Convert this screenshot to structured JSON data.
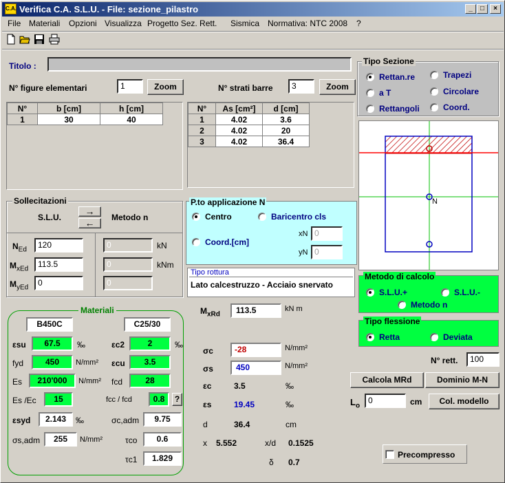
{
  "window": {
    "title": "Verifica C.A. S.L.U. - File: sezione_pilastro",
    "icon_text": "C.A.",
    "min": "_",
    "max": "□",
    "close": "×"
  },
  "menu": [
    "File",
    "Materiali",
    "Opzioni",
    "Visualizza",
    "Progetto Sez. Rett.",
    "Sismica",
    "Normativa: NTC 2008",
    "?"
  ],
  "titolo": {
    "label": "Titolo :",
    "value": ""
  },
  "figure": {
    "label": "N° figure elementari",
    "value": "1",
    "zoom": "Zoom",
    "headers": [
      "N°",
      "b [cm]",
      "h [cm]"
    ],
    "rows": [
      [
        "1",
        "30",
        "40"
      ]
    ]
  },
  "strati": {
    "label": "N° strati barre",
    "value": "3",
    "zoom": "Zoom",
    "headers": [
      "N°",
      "As [cm²]",
      "d [cm]"
    ],
    "rows": [
      [
        "1",
        "4.02",
        "3.6"
      ],
      [
        "2",
        "4.02",
        "20"
      ],
      [
        "3",
        "4.02",
        "36.4"
      ]
    ]
  },
  "tipo_sezione": {
    "title": "Tipo Sezione",
    "options": [
      "Rettan.re",
      "Trapezi",
      "a T",
      "Circolare",
      "Rettangoli",
      "Coord."
    ],
    "selected": "Rettan.re"
  },
  "sollecitazioni": {
    "title": "Sollecitazioni",
    "slu": "S.L.U.",
    "metodo": "Metodo n",
    "right_arrow": "→",
    "left_arrow": "←",
    "ned_sym": "N",
    "ned_sub": "Ed",
    "ned": "120",
    "mxed_sym": "M",
    "mxed_sub": "xEd",
    "mxed": "113.5",
    "myed_sym": "M",
    "myed_sub": "yEd",
    "myed": "0",
    "n_n": "0",
    "n_mx": "0",
    "n_my": "0",
    "unit_kn": "kN",
    "unit_knm": "kNm"
  },
  "papp": {
    "title": "P.to applicazione N",
    "centro": "Centro",
    "baricentro": "Baricentro cls",
    "coord": "Coord.[cm]",
    "xn_label": "xN",
    "xn": "0",
    "yn_label": "yN",
    "yn": "0"
  },
  "rottura": {
    "title": "Tipo rottura",
    "value": "Lato calcestruzzo - Acciaio snervato"
  },
  "metodo_calcolo": {
    "title": "Metodo di calcolo",
    "slu_plus": "S.L.U.+",
    "slu_minus": "S.L.U.-",
    "metodo_n": "Metodo n"
  },
  "tipo_flessione": {
    "title": "Tipo flessione",
    "retta": "Retta",
    "deviata": "Deviata"
  },
  "materiali": {
    "title": "Materiali",
    "steel": "B450C",
    "concrete": "C25/30",
    "esu_label": "εsu",
    "esu": "67.5",
    "esu_unit": "‰",
    "ec2_label": "εc2",
    "ec2": "2",
    "ec2_unit": "‰",
    "fyd_label": "fyd",
    "fyd": "450",
    "fyd_unit": "N/mm²",
    "ecu_label": "εcu",
    "ecu": "3.5",
    "es_label": "Es",
    "es": "210'000",
    "es_unit": "N/mm²",
    "fcd_label": "fcd",
    "fcd": "28",
    "ratio_label": "Es /Ec",
    "ratio": "15",
    "fccfcd_label": "fcc / fcd",
    "fccfcd": "0.8",
    "help": "?",
    "esyd_label": "εsyd",
    "esyd": "2.143",
    "esyd_unit": "‰",
    "scadm_label": "σc,adm",
    "scadm": "9.75",
    "ssadm_label": "σs,adm",
    "ssadm": "255",
    "ssadm_unit": "N/mm²",
    "tco_label": "τco",
    "tco": "0.6",
    "tc1_label": "τc1",
    "tc1": "1.829"
  },
  "results": {
    "mxrd_label": "M",
    "mxrd_sub": "xRd",
    "mxrd": "113.5",
    "mxrd_unit": "kN m",
    "sc_label": "σc",
    "sc": "-28",
    "sc_unit": "N/mm²",
    "ss_label": "σs",
    "ss": "450",
    "ss_unit": "N/mm²",
    "ec_label": "εc",
    "ec": "3.5",
    "ec_unit": "‰",
    "es_label": "εs",
    "es": "19.45",
    "es_unit": "‰",
    "d_label": "d",
    "d": "36.4",
    "d_unit": "cm",
    "x_label": "x",
    "x": "5.552",
    "xd_label": "x/d",
    "xd": "0.1525",
    "delta_label": "δ",
    "delta": "0.7"
  },
  "right": {
    "nrett_label": "N° rett.",
    "nrett": "100",
    "calcola": "Calcola MRd",
    "dominio": "Dominio M-N",
    "lo_label": "L",
    "lo_sub": "o",
    "lo": "0",
    "lo_unit": "cm",
    "col_modello": "Col. modello",
    "precompresso": "Precompresso"
  },
  "diagram": {
    "n_label": "N"
  }
}
